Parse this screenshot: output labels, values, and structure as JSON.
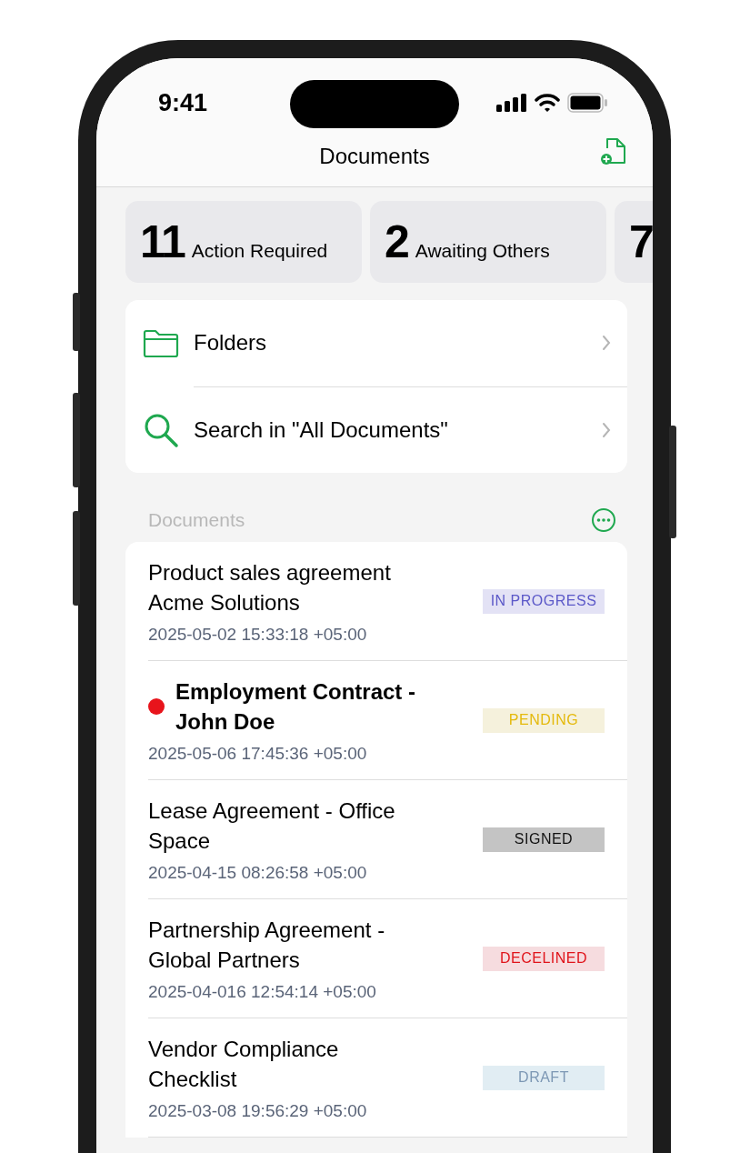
{
  "status_bar": {
    "time": "9:41"
  },
  "nav": {
    "title": "Documents"
  },
  "summary": [
    {
      "count": "11",
      "label": "Action Required"
    },
    {
      "count": "2",
      "label": "Awaiting Others"
    },
    {
      "count": "7"
    }
  ],
  "menu": [
    {
      "kind": "folder",
      "label": "Folders"
    },
    {
      "kind": "search",
      "label": "Search in \"All Documents\""
    }
  ],
  "section": {
    "title": "Documents"
  },
  "documents": [
    {
      "title": "Product sales agreement Acme Solutions",
      "date": "2025-05-02 15:33:18 +05:00",
      "status": "IN PROGRESS",
      "kind": "in_progress",
      "unread": false
    },
    {
      "title": "Employment Contract - John Doe",
      "date": "2025-05-06 17:45:36 +05:00",
      "status": "PENDING",
      "kind": "pending",
      "unread": true
    },
    {
      "title": "Lease Agreement - Office Space",
      "date": "2025-04-15 08:26:58 +05:00",
      "status": "SIGNED",
      "kind": "signed",
      "unread": false
    },
    {
      "title": "Partnership Agreement - Global Partners",
      "date": "2025-04-016 12:54:14 +05:00",
      "status": "DECELINED",
      "kind": "declined",
      "unread": false
    },
    {
      "title": "Vendor Compliance Checklist",
      "date": "2025-03-08 19:56:29 +05:00",
      "status": "DRAFT",
      "kind": "draft",
      "unread": false
    }
  ]
}
